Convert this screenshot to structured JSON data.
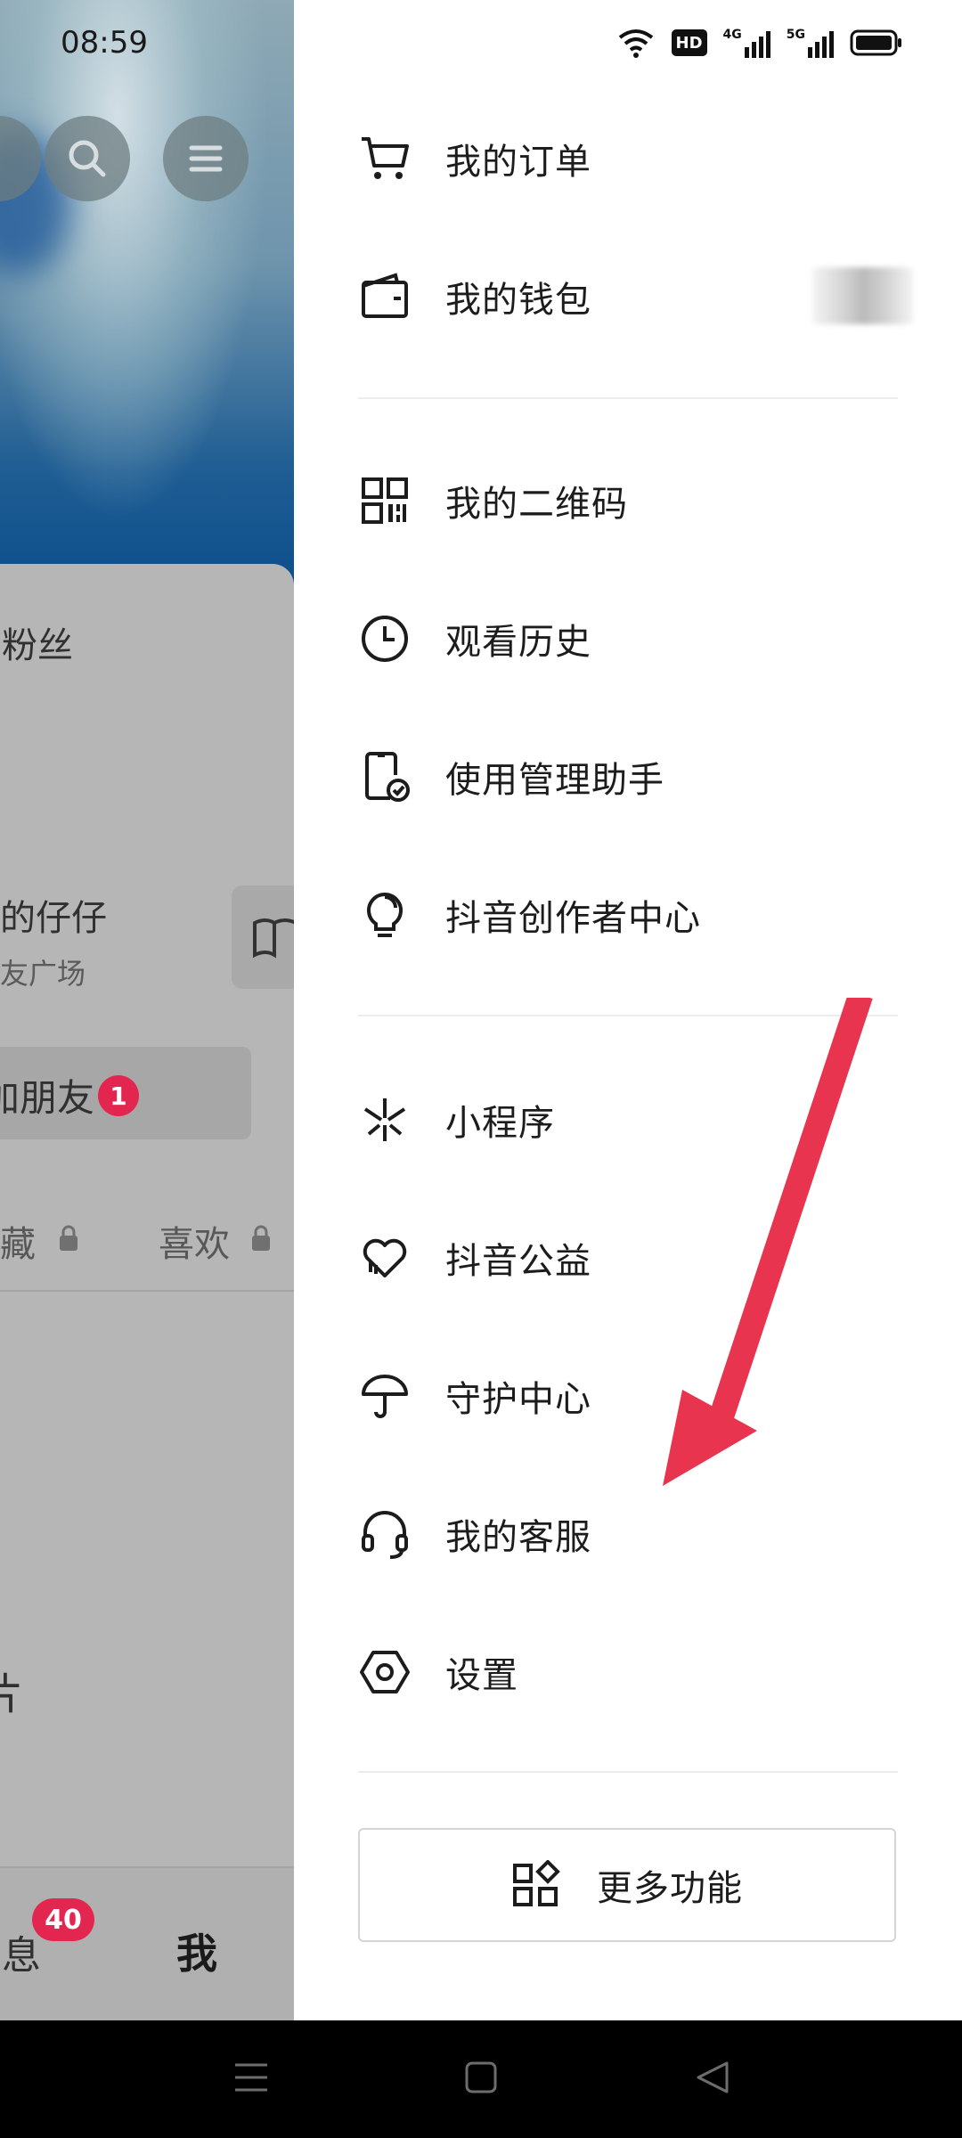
{
  "status_bar": {
    "time": "08:59",
    "hd_label": "HD",
    "net1": "4G",
    "net2": "5G",
    "icons": [
      "wifi-icon",
      "hd-icon",
      "signal-4g-icon",
      "signal-5g-icon",
      "battery-icon"
    ]
  },
  "background_profile": {
    "fans_label": "粉丝",
    "mini_card_title": "我的仔仔",
    "mini_card_subtitle": "朋友广场",
    "find_friends_label": "加朋友",
    "find_friends_badge": "1",
    "tab_collect": "收藏",
    "tab_likes": "喜欢",
    "works_fragment": "片",
    "bottom_tab_messages": "消息",
    "messages_badge": "40",
    "bottom_tab_me": "我"
  },
  "drawer": {
    "menu": [
      {
        "label": "我的订单",
        "icon": "shopping-cart-icon"
      },
      {
        "label": "我的钱包",
        "icon": "wallet-icon"
      },
      {
        "label": "我的二维码",
        "icon": "qr-code-icon"
      },
      {
        "label": "观看历史",
        "icon": "clock-icon"
      },
      {
        "label": "使用管理助手",
        "icon": "phone-check-icon"
      },
      {
        "label": "抖音创作者中心",
        "icon": "lightbulb-icon"
      },
      {
        "label": "小程序",
        "icon": "mini-program-icon"
      },
      {
        "label": "抖音公益",
        "icon": "charity-heart-icon"
      },
      {
        "label": "守护中心",
        "icon": "umbrella-icon"
      },
      {
        "label": "我的客服",
        "icon": "headset-icon"
      },
      {
        "label": "设置",
        "icon": "settings-hexagon-icon"
      }
    ],
    "more_button_label": "更多功能"
  },
  "colors": {
    "accent_badge": "#e3264f",
    "annotation_arrow": "#e8344e",
    "drawer_bg": "#ffffff"
  }
}
